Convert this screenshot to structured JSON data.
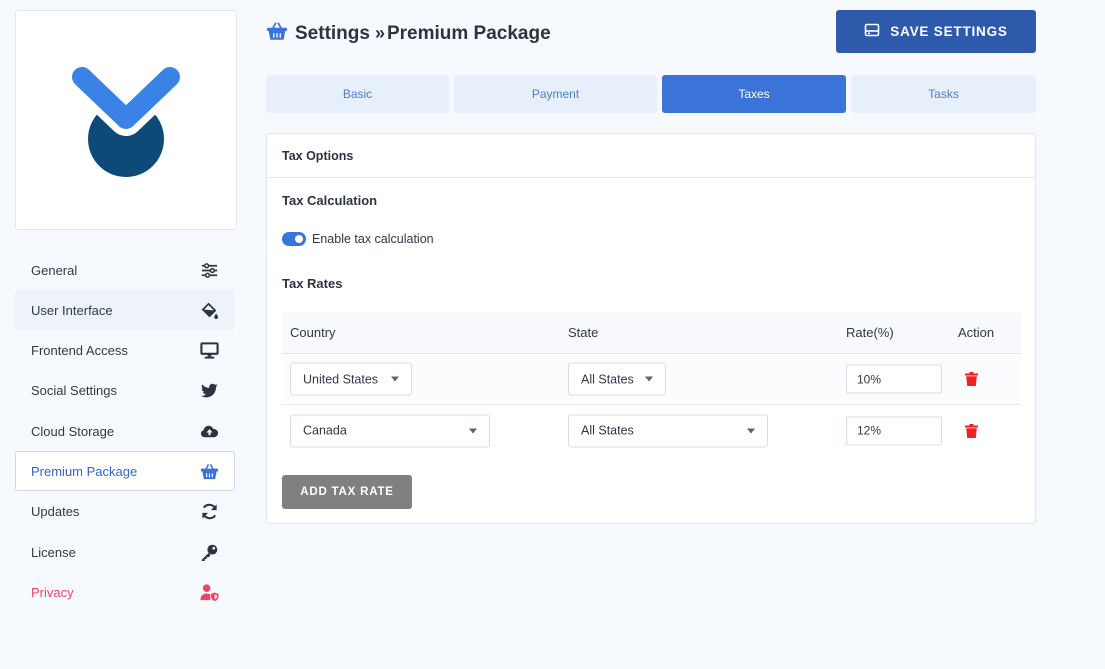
{
  "sidebar": {
    "items": [
      {
        "label": "General",
        "icon": "sliders-icon"
      },
      {
        "label": "User Interface",
        "icon": "paint-bucket-icon"
      },
      {
        "label": "Frontend Access",
        "icon": "monitor-icon"
      },
      {
        "label": "Social Settings",
        "icon": "twitter-icon"
      },
      {
        "label": "Cloud Storage",
        "icon": "cloud-upload-icon"
      },
      {
        "label": "Premium Package",
        "icon": "basket-icon"
      },
      {
        "label": "Updates",
        "icon": "sync-icon"
      },
      {
        "label": "License",
        "icon": "key-icon"
      },
      {
        "label": "Privacy",
        "icon": "user-shield-icon"
      }
    ],
    "active": "Premium Package"
  },
  "header": {
    "crumb1": "Settings",
    "separator": "»",
    "crumb2": "Premium Package",
    "save_label": "SAVE SETTINGS"
  },
  "tabs": [
    {
      "label": "Basic"
    },
    {
      "label": "Payment"
    },
    {
      "label": "Taxes"
    },
    {
      "label": "Tasks"
    }
  ],
  "panel": {
    "title": "Tax Options",
    "calc_heading": "Tax Calculation",
    "toggle_label": "Enable tax calculation",
    "toggle_on": true,
    "rates_heading": "Tax Rates",
    "columns": {
      "country": "Country",
      "state": "State",
      "rate": "Rate(%)",
      "action": "Action"
    },
    "rows": [
      {
        "country": "United States",
        "state": "All States",
        "rate": "10%"
      },
      {
        "country": "Canada",
        "state": "All States",
        "rate": "12%"
      }
    ],
    "add_label": "ADD TAX RATE"
  },
  "colors": {
    "accent": "#3a74d9",
    "save": "#2e5aac",
    "danger": "#ee2222",
    "privacy": "#ee4466"
  }
}
